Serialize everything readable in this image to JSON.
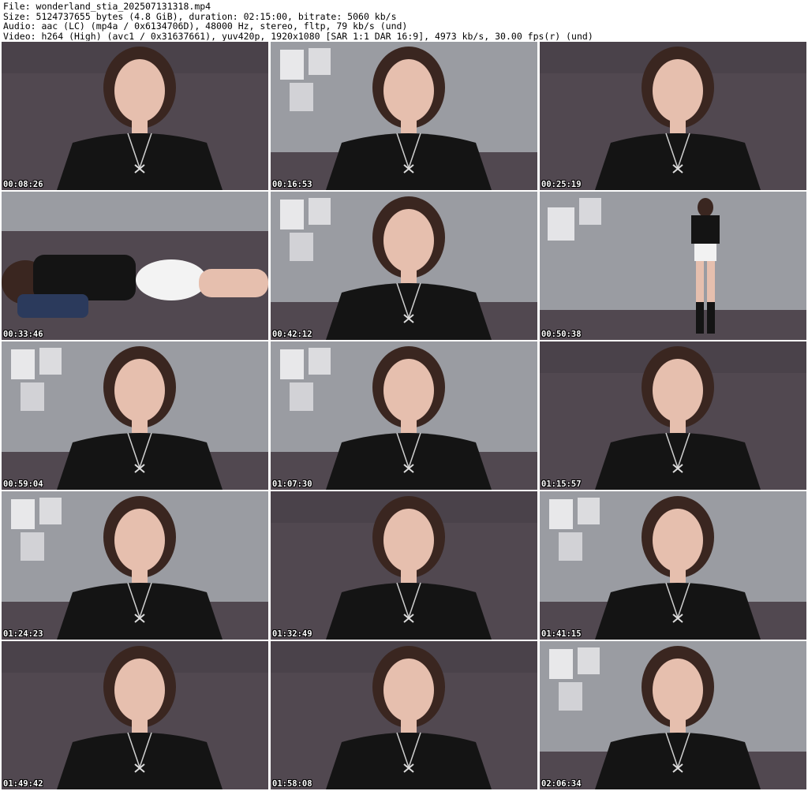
{
  "header": {
    "file": "File: wonderland_stia_202507131318.mp4",
    "size": "Size: 5124737655 bytes (4.8 GiB), duration: 02:15:00, bitrate: 5060 kb/s",
    "audio": "Audio: aac (LC) (mp4a / 0x6134706D), 48000 Hz, stereo, fltp, 79 kb/s (und)",
    "video": "Video: h264 (High) (avc1 / 0x31637661), yuv420p, 1920x1080 [SAR 1:1 DAR 16:9], 4973 kb/s, 30.00 fps(r) (und)"
  },
  "frames": [
    {
      "timestamp": "00:08:26",
      "background": "#5e5a5c",
      "scene": "couch"
    },
    {
      "timestamp": "00:16:53",
      "background": "#8d8f95",
      "scene": "wall"
    },
    {
      "timestamp": "00:25:19",
      "background": "#675d62",
      "scene": "couch"
    },
    {
      "timestamp": "00:33:46",
      "background": "#7b7980",
      "scene": "lying"
    },
    {
      "timestamp": "00:42:12",
      "background": "#8e9096",
      "scene": "wall"
    },
    {
      "timestamp": "00:50:38",
      "background": "#9fa2a8",
      "scene": "standing"
    },
    {
      "timestamp": "00:59:04",
      "background": "#8c8e94",
      "scene": "wall"
    },
    {
      "timestamp": "01:07:30",
      "background": "#8f9197",
      "scene": "wall"
    },
    {
      "timestamp": "01:15:57",
      "background": "#6a6065",
      "scene": "couch"
    },
    {
      "timestamp": "01:24:23",
      "background": "#7f8187",
      "scene": "wall"
    },
    {
      "timestamp": "01:32:49",
      "background": "#615a60",
      "scene": "couch"
    },
    {
      "timestamp": "01:41:15",
      "background": "#878990",
      "scene": "wall"
    },
    {
      "timestamp": "01:49:42",
      "background": "#6b6368",
      "scene": "couch"
    },
    {
      "timestamp": "01:58:08",
      "background": "#5f585e",
      "scene": "couch"
    },
    {
      "timestamp": "02:06:34",
      "background": "#8a8c92",
      "scene": "wall"
    }
  ],
  "colors": {
    "shirt": "#141414",
    "skin": "#e6bfae",
    "hair": "#3a2620",
    "couch": "#514850",
    "wall": "#9a9ca2",
    "timestamp_text": "#ffffff"
  }
}
